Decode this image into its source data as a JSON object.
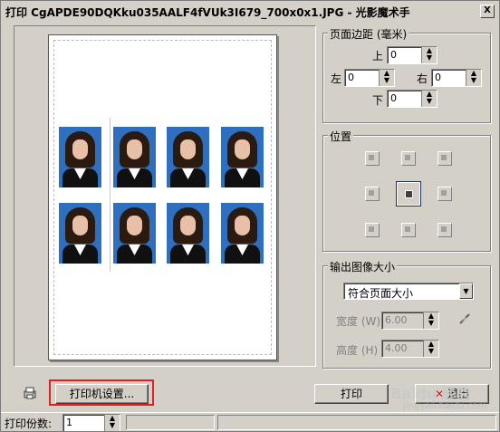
{
  "window": {
    "title": "打印 CgAPDE90DQKku035AALF4fVUk3I679_700x0x1.JPG - 光影魔术手",
    "close_glyph": "X"
  },
  "margins": {
    "group_label": "页面边距 (毫米)",
    "top_label": "上",
    "top_value": "0",
    "left_label": "左",
    "left_value": "0",
    "right_label": "右",
    "right_value": "0",
    "bottom_label": "下",
    "bottom_value": "0"
  },
  "position": {
    "group_label": "位置",
    "selected": "center"
  },
  "output_size": {
    "group_label": "输出图像大小",
    "mode_selected": "符合页面大小",
    "width_label": "宽度 (W)",
    "width_value": "6.00",
    "height_label": "高度 (H)",
    "height_value": "4.00"
  },
  "buttons": {
    "printer_setup": "打印机设置...",
    "print": "打印",
    "exit": "退出"
  },
  "statusbar": {
    "copies_label": "打印份数:",
    "copies_value": "1"
  },
  "watermark": {
    "brand": "Baidu 经验",
    "url": "jingyan.baidu.com"
  },
  "icons": {
    "spin": "spin-arrows-icon",
    "link": "link-chain-icon",
    "printer_props": "printer-properties-icon"
  }
}
